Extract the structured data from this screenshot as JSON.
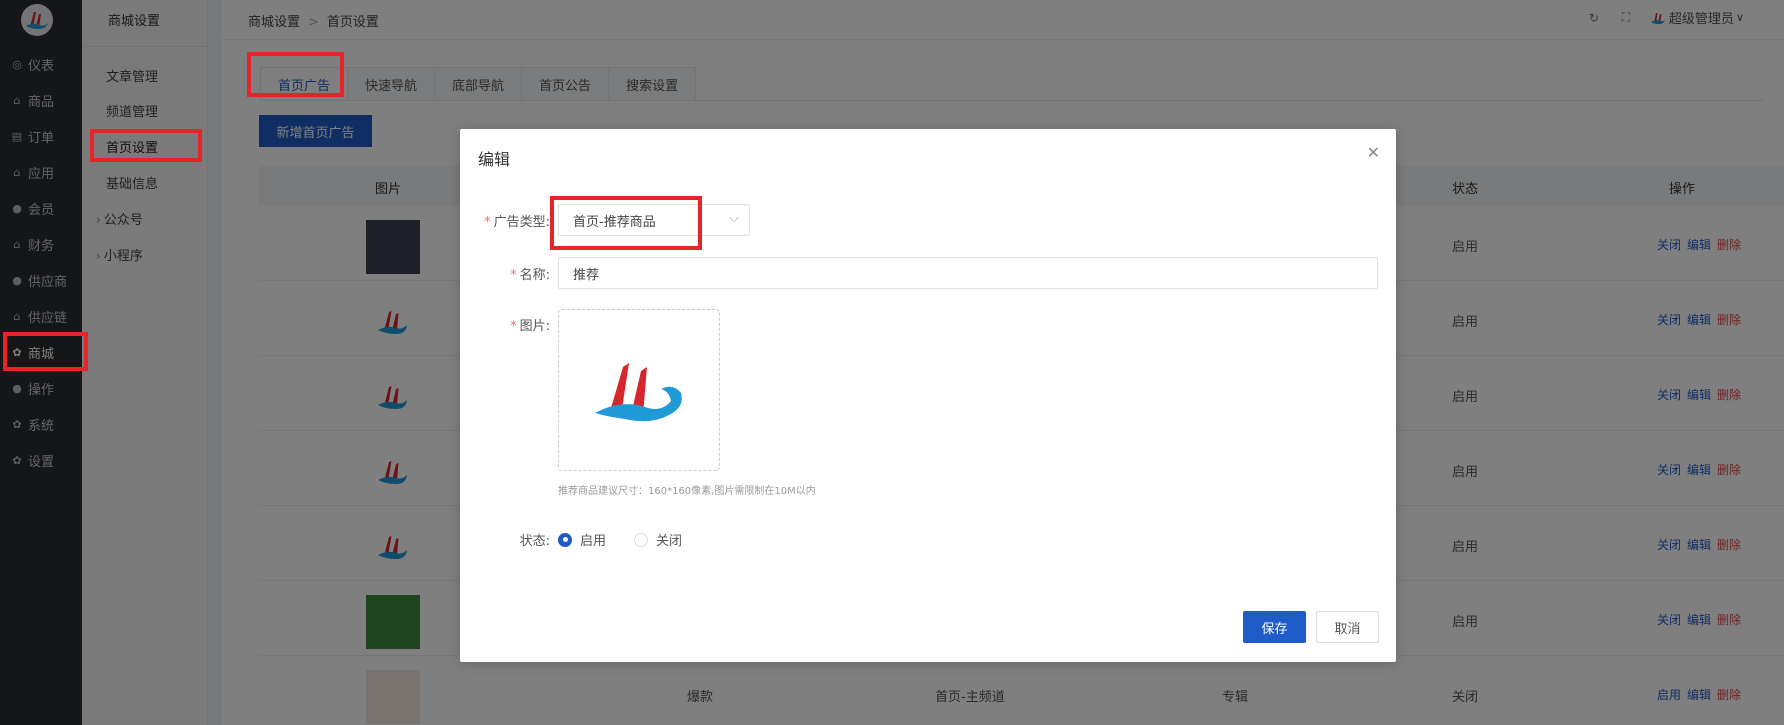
{
  "sidebar": {
    "items": [
      {
        "label": "仪表",
        "icon": "dashboard-icon",
        "glyph": "◎"
      },
      {
        "label": "商品",
        "icon": "bag-icon",
        "glyph": "⌂"
      },
      {
        "label": "订单",
        "icon": "order-icon",
        "glyph": "▤"
      },
      {
        "label": "应用",
        "icon": "app-icon",
        "glyph": "⌂"
      },
      {
        "label": "会员",
        "icon": "user-icon",
        "glyph": "●"
      },
      {
        "label": "财务",
        "icon": "finance-icon",
        "glyph": "⌂"
      },
      {
        "label": "供应商",
        "icon": "user-icon",
        "glyph": "●"
      },
      {
        "label": "供应链",
        "icon": "bag-icon",
        "glyph": "⌂"
      },
      {
        "label": "商城",
        "icon": "gear-icon",
        "glyph": "✿"
      },
      {
        "label": "操作",
        "icon": "user-icon",
        "glyph": "●"
      },
      {
        "label": "系统",
        "icon": "gear-icon",
        "glyph": "✿"
      },
      {
        "label": "设置",
        "icon": "gear-icon",
        "glyph": "✿"
      }
    ]
  },
  "submenu": {
    "title": "商城设置",
    "items": [
      {
        "label": "文章管理"
      },
      {
        "label": "频道管理"
      },
      {
        "label": "首页设置"
      },
      {
        "label": "基础信息"
      },
      {
        "label": "公众号"
      },
      {
        "label": "小程序"
      }
    ]
  },
  "header": {
    "crumb1": "商城设置",
    "crumb2": "首页设置",
    "user": "超级管理员"
  },
  "tabs": [
    "首页广告",
    "快速导航",
    "底部导航",
    "首页公告",
    "搜索设置"
  ],
  "add_button": "新增首页广告",
  "table": {
    "headers": {
      "image": "图片",
      "status": "状态",
      "ops": "操作"
    },
    "rows": [
      {
        "status": "启用",
        "op1": "关闭",
        "op2": "编辑",
        "op3": "删除"
      },
      {
        "status": "启用",
        "op1": "关闭",
        "op2": "编辑",
        "op3": "删除"
      },
      {
        "status": "启用",
        "op1": "关闭",
        "op2": "编辑",
        "op3": "删除"
      },
      {
        "status": "启用",
        "op1": "关闭",
        "op2": "编辑",
        "op3": "删除"
      },
      {
        "status": "启用",
        "op1": "关闭",
        "op2": "编辑",
        "op3": "删除"
      },
      {
        "status": "启用",
        "op1": "关闭",
        "op2": "编辑",
        "op3": "删除"
      },
      {
        "c2": "爆款",
        "c3": "首页-主频道",
        "c4": "专辑",
        "status": "关闭",
        "op1": "启用",
        "op2": "编辑",
        "op3": "删除"
      }
    ]
  },
  "dialog": {
    "title": "编辑",
    "type_label": "广告类型:",
    "type_value": "首页-推荐商品",
    "name_label": "名称:",
    "name_value": "推荐",
    "image_label": "图片:",
    "hint": "推荐商品建议尺寸：160*160像素,图片需限制在10M以内",
    "status_label": "状态:",
    "status_on": "启用",
    "status_off": "关闭",
    "save": "保存",
    "cancel": "取消"
  },
  "colors": {
    "primary": "#1f5cc8",
    "danger": "#e04848",
    "highlight": "#e8232a",
    "sidebar_bg": "#2b2d30"
  }
}
